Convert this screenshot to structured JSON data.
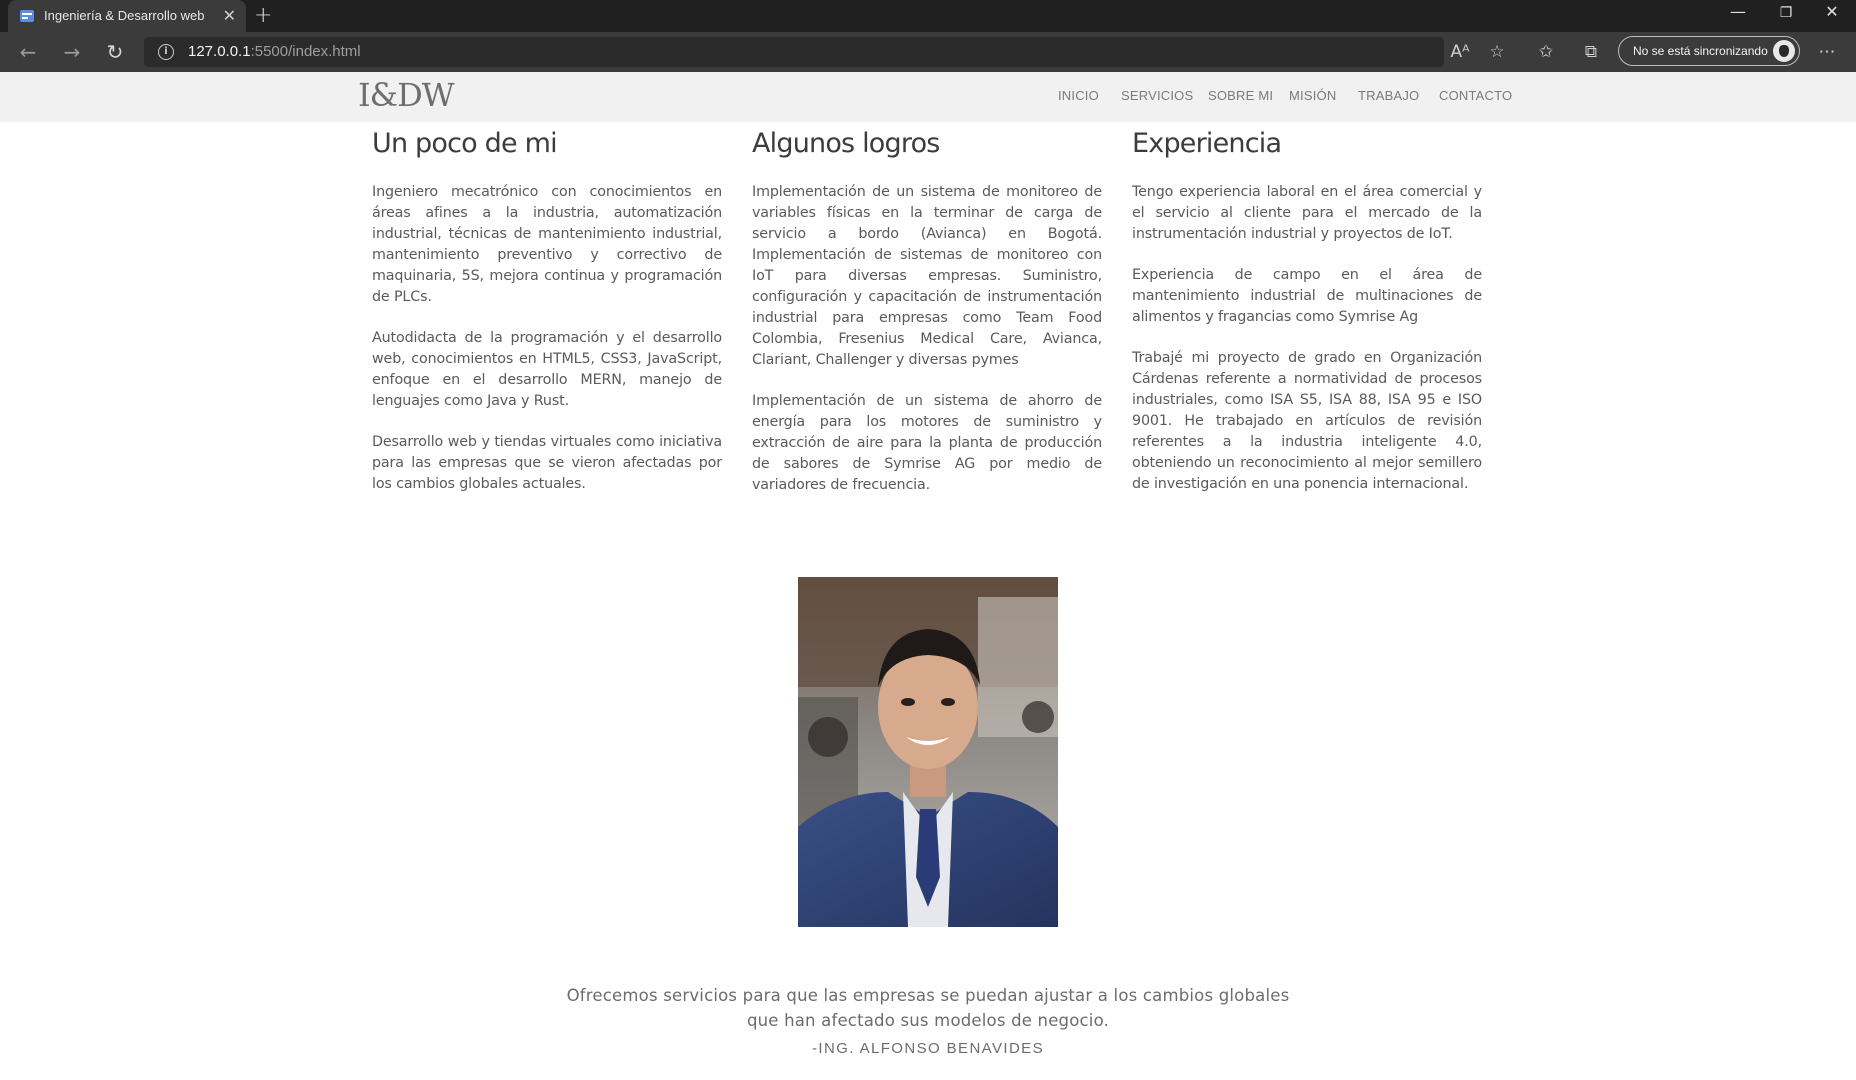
{
  "browser": {
    "tab_title": "Ingeniería & Desarrollo web",
    "url_host": "127.0.0.1",
    "url_path": ":5500/index.html",
    "sync_label": "No se está sincronizando"
  },
  "site": {
    "logo": "I&DW",
    "nav": [
      "INICIO",
      "SERVICIOS",
      "SOBRE MI",
      "MISIÓN",
      "TRABAJO",
      "CONTACTO"
    ]
  },
  "columns": [
    {
      "heading": "Un poco de mi",
      "paragraphs": [
        "Ingeniero mecatrónico con conocimientos en áreas afines a la industria, automatización industrial, técnicas de mantenimiento industrial, mantenimiento preventivo y correctivo de maquinaria, 5S, mejora continua y programación de PLCs.",
        "Autodidacta de la programación y el desarrollo web, conocimientos en HTML5, CSS3, JavaScript, enfoque en el desarrollo MERN, manejo de lenguajes como Java y Rust.",
        "Desarrollo web y tiendas virtuales como iniciativa para las empresas que se vieron afectadas por los cambios globales actuales."
      ]
    },
    {
      "heading": "Algunos logros",
      "paragraphs": [
        "Implementación de un sistema de monitoreo de variables físicas en la terminar de carga de servicio a bordo (Avianca) en Bogotá. Implementación de sistemas de monitoreo con IoT para diversas empresas. Suministro, configuración y capacitación de instrumentación industrial para empresas como Team Food Colombia, Fresenius Medical Care, Avianca, Clariant, Challenger y diversas pymes",
        "Implementación de un sistema de ahorro de energía para los motores de suministro y extracción de aire para la planta de producción de sabores de Symrise AG por medio de variadores de frecuencia."
      ]
    },
    {
      "heading": "Experiencia",
      "paragraphs": [
        "Tengo experiencia laboral en el área comercial y el servicio al cliente para el mercado de la instrumentación industrial y proyectos de IoT.",
        "Experiencia de campo en el área de mantenimiento industrial de multinaciones de alimentos y fragancias como Symrise Ag",
        "Trabajé mi proyecto de grado en Organización Cárdenas referente a normatividad de procesos industriales, como ISA S5, ISA 88, ISA 95 e ISO 9001. He trabajado en artículos de revisión referentes a la industria inteligente 4.0, obteniendo un reconocimiento al mejor semillero de investigación en una ponencia internacional."
      ]
    }
  ],
  "quote": {
    "text": "Ofrecemos servicios para que las empresas se puedan ajustar a los cambios globales que han afectado sus modelos de negocio.",
    "author": "-ING. ALFONSO BENAVIDES"
  },
  "icons": {
    "back": "arrow-left-icon",
    "forward": "arrow-right-icon",
    "refresh": "refresh-icon",
    "site_info": "info-icon",
    "read_aloud": "read-aloud-icon",
    "favorite": "star-icon",
    "favorites": "favorites-icon",
    "collections": "collections-icon",
    "more": "more-icon"
  }
}
